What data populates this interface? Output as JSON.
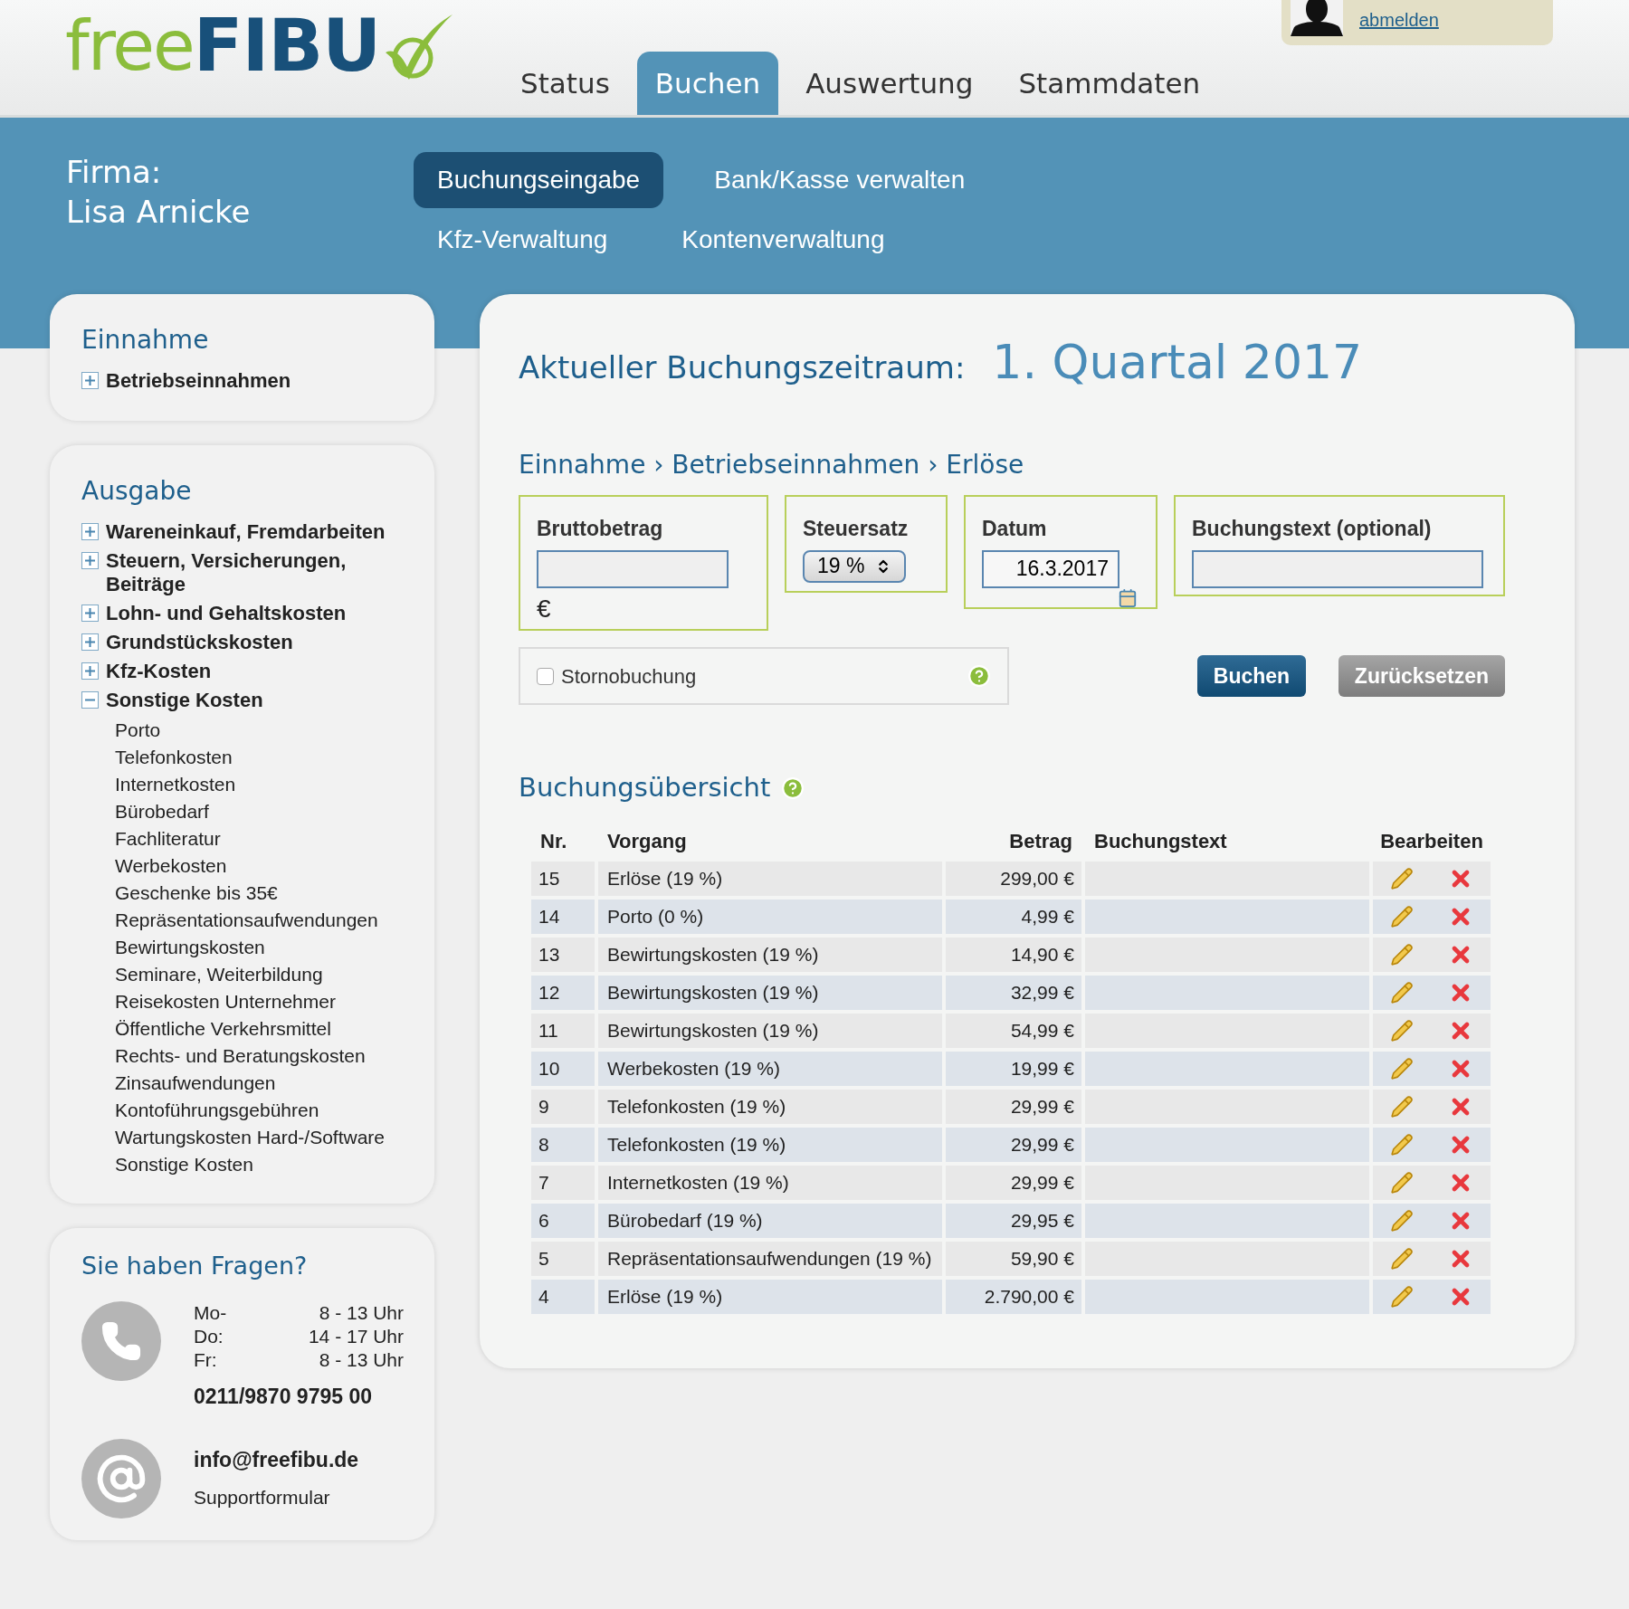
{
  "logo": {
    "part_1": "free",
    "part_2": "FIBU"
  },
  "user": {
    "logout": "abmelden"
  },
  "main_tabs": [
    {
      "label": "Status",
      "selected": false
    },
    {
      "label": "Buchen",
      "selected": true
    },
    {
      "label": "Auswertung",
      "selected": false
    },
    {
      "label": "Stammdaten",
      "selected": false
    }
  ],
  "firma": {
    "label": "Firma:",
    "name": "Lisa Arnicke"
  },
  "sub_tabs": [
    {
      "label": "Buchungseingabe",
      "selected": true
    },
    {
      "label": "Bank/Kasse verwalten",
      "selected": false
    },
    {
      "label": "Kfz-Verwaltung",
      "selected": false
    },
    {
      "label": "Kontenverwaltung",
      "selected": false
    }
  ],
  "sidebar": [
    {
      "title": "Einnahme",
      "items": [
        {
          "label": "Betriebseinnahmen",
          "expanded": false
        }
      ]
    },
    {
      "title": "Ausgabe",
      "items": [
        {
          "label": "Wareneinkauf, Fremdarbeiten",
          "expanded": false
        },
        {
          "label": "Steuern, Versicherungen, Beiträge",
          "expanded": false
        },
        {
          "label": "Lohn- und Gehaltskosten",
          "expanded": false
        },
        {
          "label": "Grundstückskosten",
          "expanded": false
        },
        {
          "label": "Kfz-Kosten",
          "expanded": false
        },
        {
          "label": "Sonstige Kosten",
          "expanded": true,
          "children": [
            {
              "label": "Porto"
            },
            {
              "label": "Telefonkosten"
            },
            {
              "label": "Internetkosten"
            },
            {
              "label": "Bürobedarf"
            },
            {
              "label": "Fachliteratur"
            },
            {
              "label": "Werbekosten"
            },
            {
              "label": "Geschenke bis 35€"
            },
            {
              "label": "Repräsentationsaufwendungen"
            },
            {
              "label": "Bewirtungskosten"
            },
            {
              "label": "Seminare, Weiterbildung"
            },
            {
              "label": "Reisekosten Unternehmer"
            },
            {
              "label": "Öffentliche Verkehrsmittel"
            },
            {
              "label": "Rechts- und Beratungskosten"
            },
            {
              "label": "Zinsaufwendungen"
            },
            {
              "label": "Kontoführungsgebühren"
            },
            {
              "label": "Wartungskosten Hard-/Software"
            },
            {
              "label": "Sonstige Kosten"
            }
          ]
        }
      ]
    }
  ],
  "contact": {
    "title": "Sie haben Fragen?",
    "hours": [
      {
        "day": "Mo-",
        "time": "8 - 13 Uhr"
      },
      {
        "day": "Do:",
        "time": "14 - 17 Uhr"
      },
      {
        "day": "Fr:",
        "time": "8 - 13 Uhr"
      }
    ],
    "phone": "0211/9870 9795 00",
    "email": "info@freefibu.de",
    "support": "Supportformular"
  },
  "period": {
    "label": "Aktueller Buchungszeitraum:",
    "value": "1. Quartal 2017"
  },
  "breadcrumb": "Einnahme › Betriebseinnahmen › Erlöse",
  "form": [
    {
      "kind": "amount",
      "label": "Bruttobetrag",
      "unit": "€"
    },
    {
      "kind": "select",
      "label": "Steuersatz",
      "value": "19 %"
    },
    {
      "kind": "date",
      "label": "Datum",
      "value": "16.3.2017"
    },
    {
      "kind": "text",
      "label": "Buchungstext (optional)"
    }
  ],
  "storno": {
    "label": "Stornobuchung",
    "checked": false
  },
  "buttons": [
    {
      "label": "Buchen",
      "kind": "primary"
    },
    {
      "label": "Zurücksetzen",
      "kind": "secondary"
    }
  ],
  "overview": {
    "title": "Buchungsübersicht",
    "columns": [
      "Nr.",
      "Vorgang",
      "Betrag",
      "Buchungstext",
      "Bearbeiten"
    ],
    "rows": [
      {
        "nr": "15",
        "vorgang": "Erlöse (19 %)",
        "betrag": "299,00 €"
      },
      {
        "nr": "14",
        "vorgang": "Porto (0 %)",
        "betrag": "4,99 €"
      },
      {
        "nr": "13",
        "vorgang": "Bewirtungskosten (19 %)",
        "betrag": "14,90 €"
      },
      {
        "nr": "12",
        "vorgang": "Bewirtungskosten (19 %)",
        "betrag": "32,99 €"
      },
      {
        "nr": "11",
        "vorgang": "Bewirtungskosten (19 %)",
        "betrag": "54,99 €"
      },
      {
        "nr": "10",
        "vorgang": "Werbekosten (19 %)",
        "betrag": "19,99 €"
      },
      {
        "nr": "9",
        "vorgang": "Telefonkosten (19 %)",
        "betrag": "29,99 €"
      },
      {
        "nr": "8",
        "vorgang": "Telefonkosten (19 %)",
        "betrag": "29,99 €"
      },
      {
        "nr": "7",
        "vorgang": "Internetkosten (19 %)",
        "betrag": "29,99 €"
      },
      {
        "nr": "6",
        "vorgang": "Bürobedarf (19 %)",
        "betrag": "29,95 €"
      },
      {
        "nr": "5",
        "vorgang": "Repräsentationsaufwendungen (19 %)",
        "betrag": "59,90 €"
      },
      {
        "nr": "4",
        "vorgang": "Erlöse (19 %)",
        "betrag": "2.790,00 €"
      }
    ]
  }
}
